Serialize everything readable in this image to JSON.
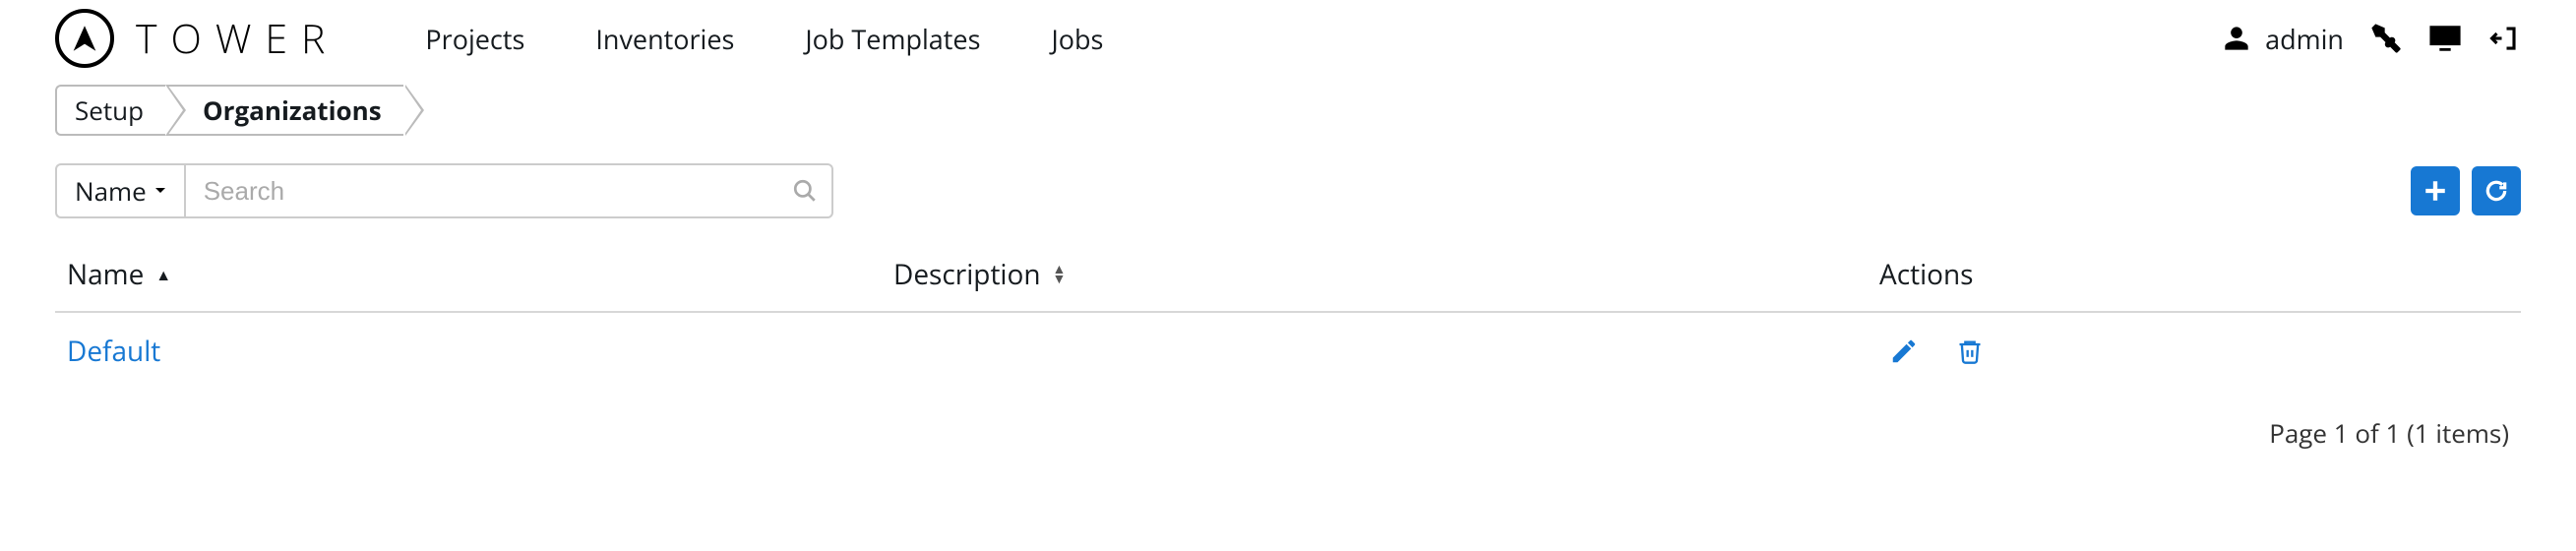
{
  "brand": {
    "text": "TOWER"
  },
  "nav": {
    "links": [
      "Projects",
      "Inventories",
      "Job Templates",
      "Jobs"
    ],
    "user": "admin"
  },
  "breadcrumbs": {
    "items": [
      "Setup",
      "Organizations"
    ]
  },
  "search": {
    "filter_label": "Name",
    "placeholder": "Search"
  },
  "columns": {
    "name": "Name",
    "description": "Description",
    "actions": "Actions"
  },
  "rows": [
    {
      "name": "Default",
      "description": ""
    }
  ],
  "pagination": "Page 1 of 1 (1 items)"
}
